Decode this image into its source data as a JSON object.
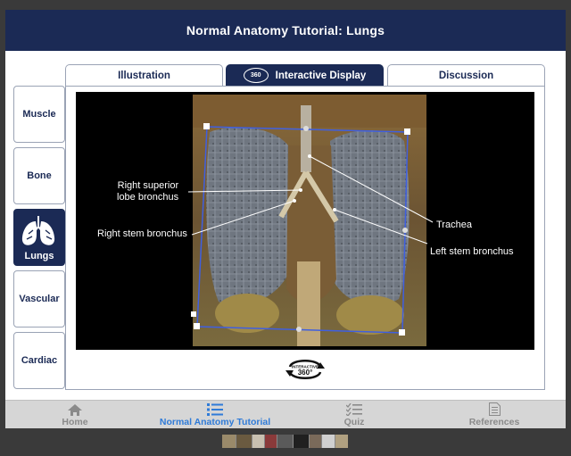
{
  "header": {
    "title": "Normal Anatomy Tutorial: Lungs"
  },
  "tabs": [
    {
      "label": "Illustration"
    },
    {
      "label": "Interactive Display",
      "badge": "360"
    },
    {
      "label": "Discussion"
    }
  ],
  "sidebar": {
    "items": [
      {
        "label": "Muscle"
      },
      {
        "label": "Bone"
      },
      {
        "label": "Lungs",
        "icon": "lungs-icon",
        "active": true
      },
      {
        "label": "Vascular"
      },
      {
        "label": "Cardiac"
      }
    ]
  },
  "viewer": {
    "annotations": [
      {
        "line1": "Right superior",
        "line2": "lobe bronchus"
      },
      {
        "text": "Right stem bronchus"
      },
      {
        "text": "Trachea"
      },
      {
        "text": "Left stem bronchus"
      }
    ],
    "rotate_control": {
      "top": "INTERACTIVE",
      "bottom": "360°"
    }
  },
  "bottom_nav": {
    "items": [
      {
        "label": "Home",
        "icon": "home-icon"
      },
      {
        "label": "Normal Anatomy Tutorial",
        "icon": "list-icon",
        "active": true
      },
      {
        "label": "Quiz",
        "icon": "checklist-icon"
      },
      {
        "label": "References",
        "icon": "document-icon"
      }
    ]
  },
  "colors": {
    "brand_navy": "#1b2a55",
    "active_blue": "#2f7bd8",
    "bounding_box": "#3f5fe0"
  }
}
